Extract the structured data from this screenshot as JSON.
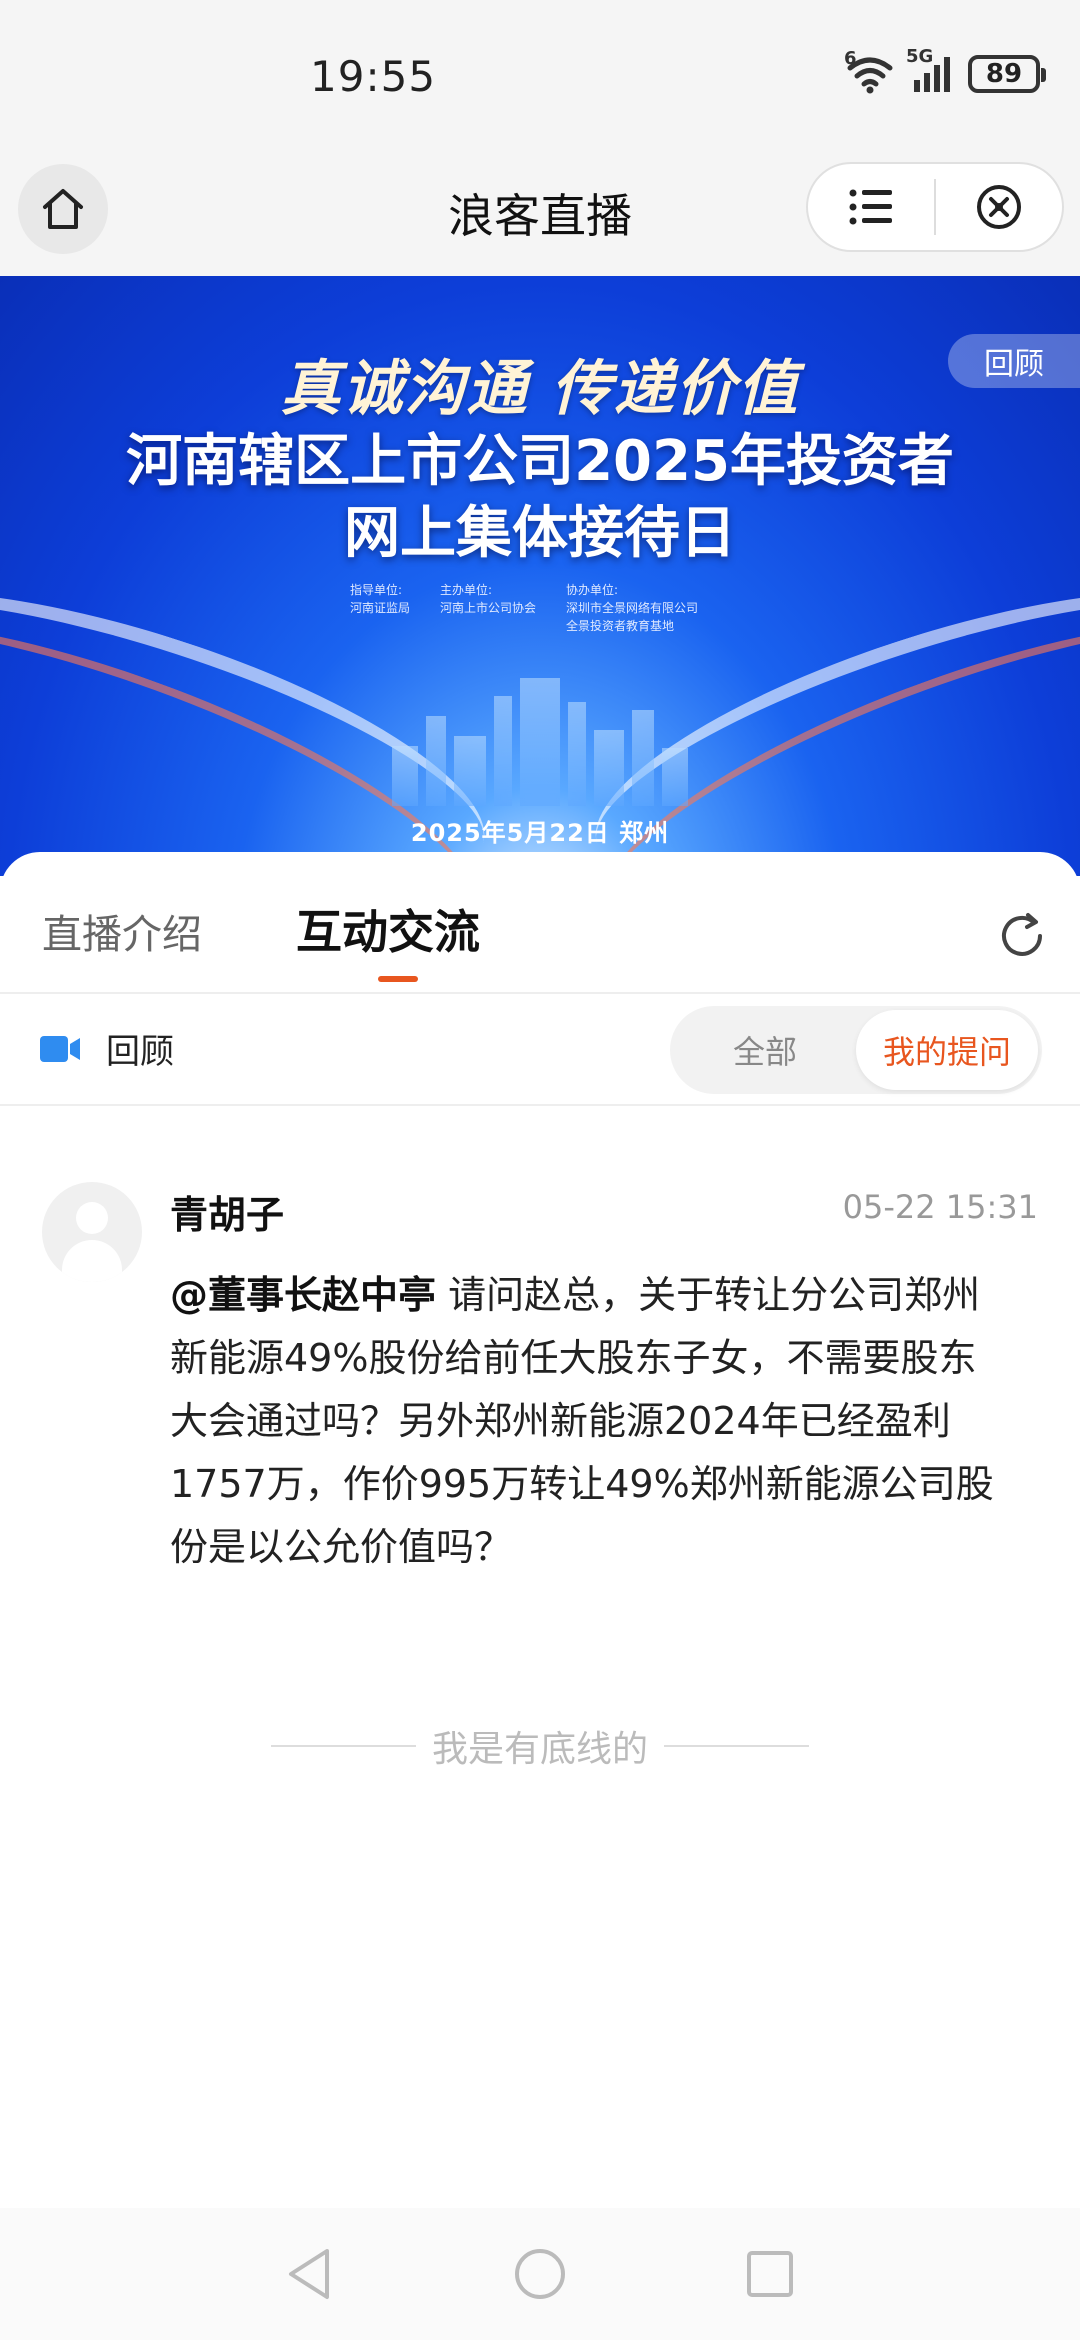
{
  "status_bar": {
    "time": "19:55",
    "wifi_label": "6",
    "network_label": "5G",
    "battery": "89"
  },
  "nav": {
    "title": "浪客直播",
    "home_icon": "home-icon",
    "menu_icon": "list-icon",
    "close_icon": "close-circle-icon"
  },
  "banner": {
    "slogan": "真诚沟通  传递价值",
    "title_line1": "河南辖区上市公司2025年投资者",
    "title_line2": "网上集体接待日",
    "orgs": [
      {
        "label": "指导单位:",
        "value": "河南证监局"
      },
      {
        "label": "主办单位:",
        "value": "河南上市公司协会"
      },
      {
        "label": "协办单位:",
        "value": "深圳市全景网络有限公司\n全景投资者教育基地"
      }
    ],
    "date": "2025年5月22日  郑州",
    "badge": "回顾"
  },
  "tabs": {
    "intro": "直播介绍",
    "interact": "互动交流"
  },
  "filter": {
    "replay_label": "回顾",
    "all": "全部",
    "mine": "我的提问"
  },
  "post": {
    "user": "青胡子",
    "time": "05-22 15:31",
    "mention": "@董事长赵中亭",
    "text": " 请问赵总，关于转让分公司郑州新能源49%股份给前任大股东子女，不需要股东大会通过吗？另外郑州新能源2024年已经盈利1757万，作价995万转让49%郑州新能源公司股份是以公允价值吗？"
  },
  "footer_note": "我是有底线的",
  "colors": {
    "accent": "#e8561f",
    "banner_blue": "#1a63f0",
    "video_icon": "#2f8cf0"
  }
}
